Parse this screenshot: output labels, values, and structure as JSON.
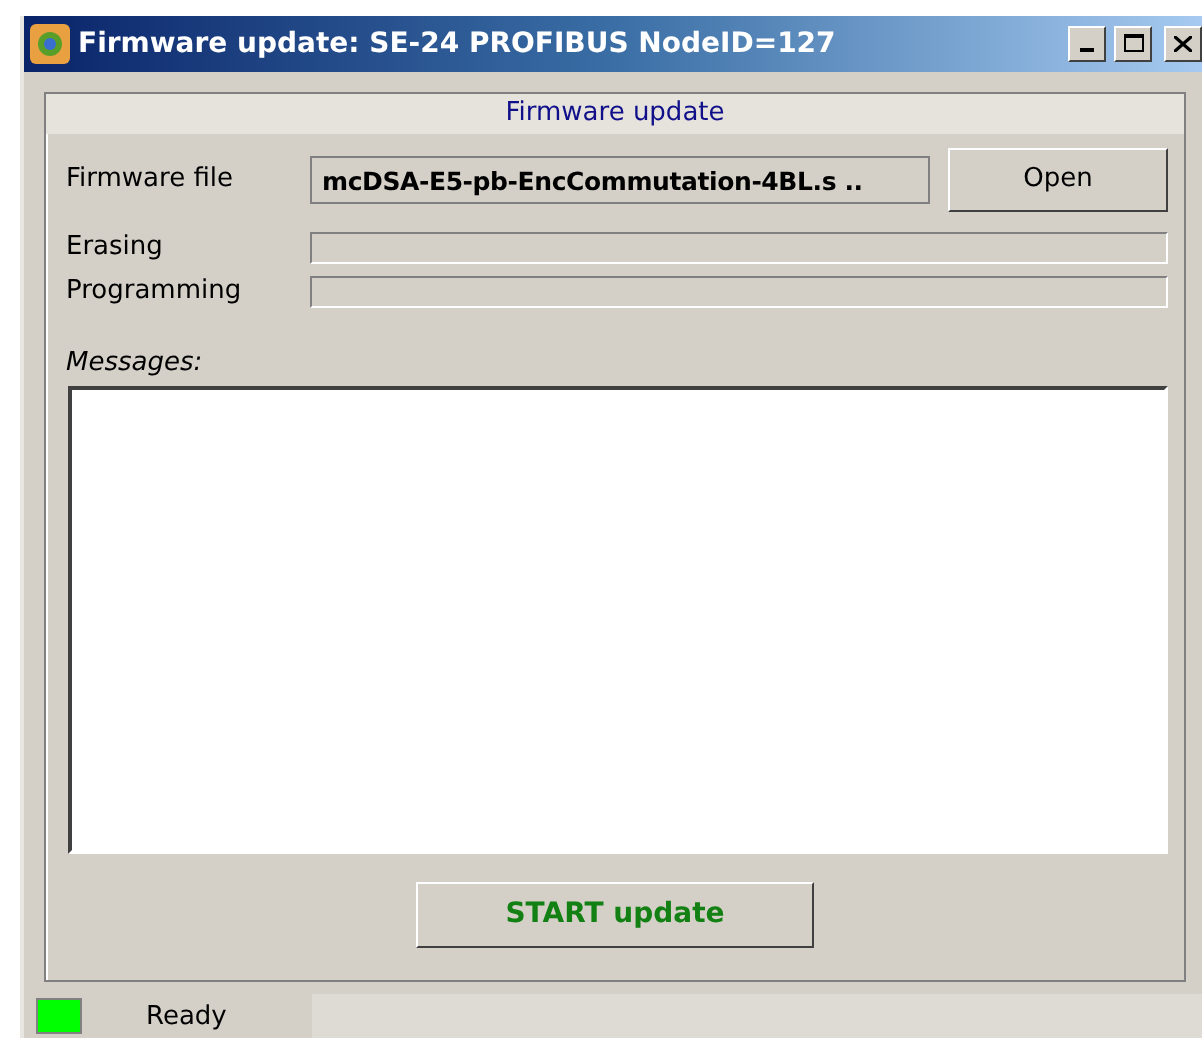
{
  "window": {
    "title": "Firmware update: SE-24 PROFIBUS NodeID=127"
  },
  "group": {
    "title": "Firmware update"
  },
  "firmware_file": {
    "label": "Firmware file",
    "value": "mcDSA-E5-pb-EncCommutation-4BL.s ..",
    "button": "Open"
  },
  "progress": [
    {
      "label": "Erasing",
      "level": 0
    },
    {
      "label": "Programming",
      "level": 0
    }
  ],
  "messages": {
    "label": "Messages:"
  },
  "start_button": "START update",
  "status_bar": {
    "text": "Ready"
  }
}
